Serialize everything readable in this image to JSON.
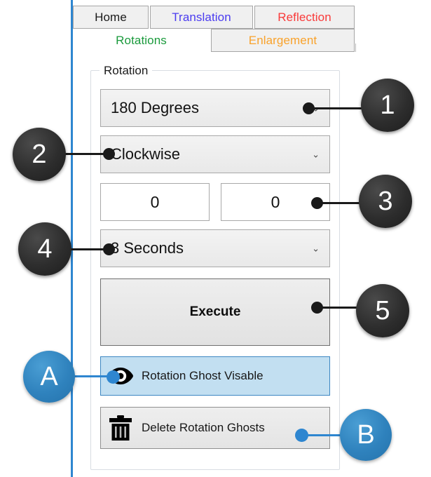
{
  "tabs": {
    "row1": [
      {
        "label": "Home",
        "color": "#1a1a1a",
        "selected": false
      },
      {
        "label": "Translation",
        "color": "#4a3bf0",
        "selected": false
      },
      {
        "label": "Reflection",
        "color": "#f93a3a",
        "selected": false
      }
    ],
    "row2": [
      {
        "label": "Rotations",
        "color": "#1a9a3c",
        "selected": true
      },
      {
        "label": "Enlargement",
        "color": "#f9a22b",
        "selected": false
      }
    ]
  },
  "group": {
    "title": "Rotation"
  },
  "controls": {
    "degrees": {
      "value": "180 Degrees",
      "chevron": "⌄"
    },
    "direction": {
      "value": "Clockwise",
      "chevron": "⌄"
    },
    "x_value": "0",
    "y_value": "0",
    "duration": {
      "value": "3 Seconds",
      "chevron": "⌄"
    },
    "execute_label": "Execute",
    "ghost_toggle": {
      "label": "Rotation Ghost Visable",
      "icon": "eye-icon",
      "active": true
    },
    "delete_ghosts": {
      "label": "Delete Rotation Ghosts",
      "icon": "trash-icon",
      "active": false
    }
  },
  "callouts": {
    "c1": "1",
    "c2": "2",
    "c3": "3",
    "c4": "4",
    "c5": "5",
    "cA": "A",
    "cB": "B"
  },
  "colors": {
    "callout_number_bg": "#2d2d2d",
    "callout_letter_bg": "#2f82bd",
    "active_button_bg": "#c2dff1",
    "active_button_border": "#3d87c2",
    "left_rule": "#2e86d0"
  }
}
